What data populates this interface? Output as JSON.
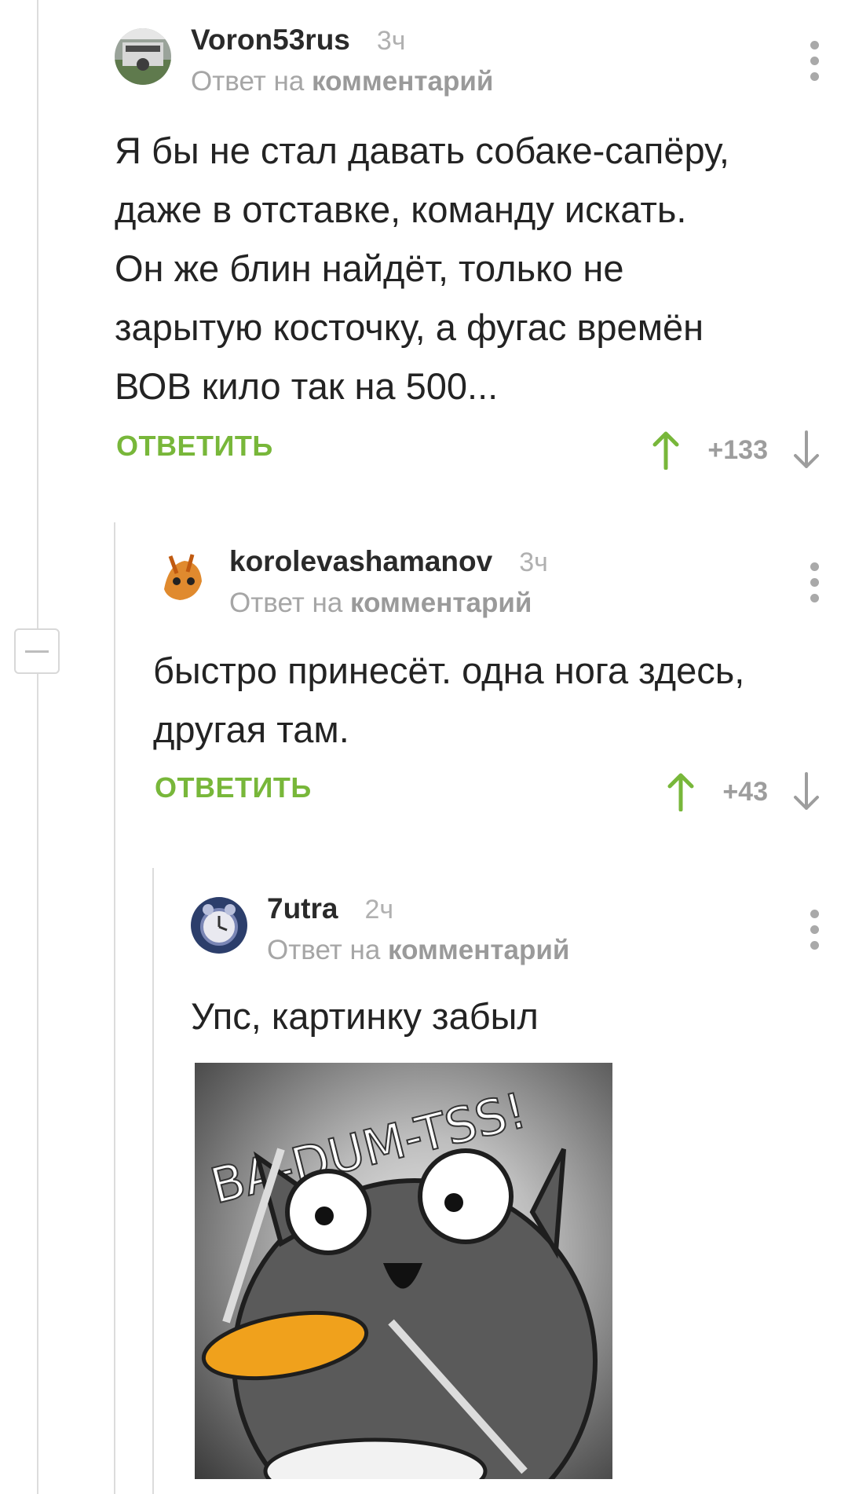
{
  "comments": [
    {
      "author": "Voron53rus",
      "time": "3ч",
      "reply_prefix": "Ответ на",
      "reply_target": "комментарий",
      "text": "Я бы не стал давать собаке-сапёру,\nдаже в отставке, команду искать.\nОн же блин найдёт, только не\nзарытую косточку, а фугас времён\nВОВ кило так на 500...",
      "reply_label": "ОТВЕТИТЬ",
      "rating": "+133"
    },
    {
      "author": "korolevashamanov",
      "time": "3ч",
      "reply_prefix": "Ответ на",
      "reply_target": "комментарий",
      "text": "быстро принесёт. одна нога здесь,\nдругая там.",
      "reply_label": "ОТВЕТИТЬ",
      "rating": "+43"
    },
    {
      "author": "7utra",
      "time": "2ч",
      "reply_prefix": "Ответ на",
      "reply_target": "комментарий",
      "text": "Упс, картинку забыл"
    }
  ],
  "meme": {
    "caption": "BA-DUM-TSS!"
  },
  "colors": {
    "accent_green": "#78b73a",
    "muted": "#a6a6a6",
    "thread_line": "#dcdcdc"
  },
  "icons": [
    "avatar",
    "more-vert-icon",
    "arrow-up-icon",
    "arrow-down-icon",
    "collapse-icon"
  ]
}
